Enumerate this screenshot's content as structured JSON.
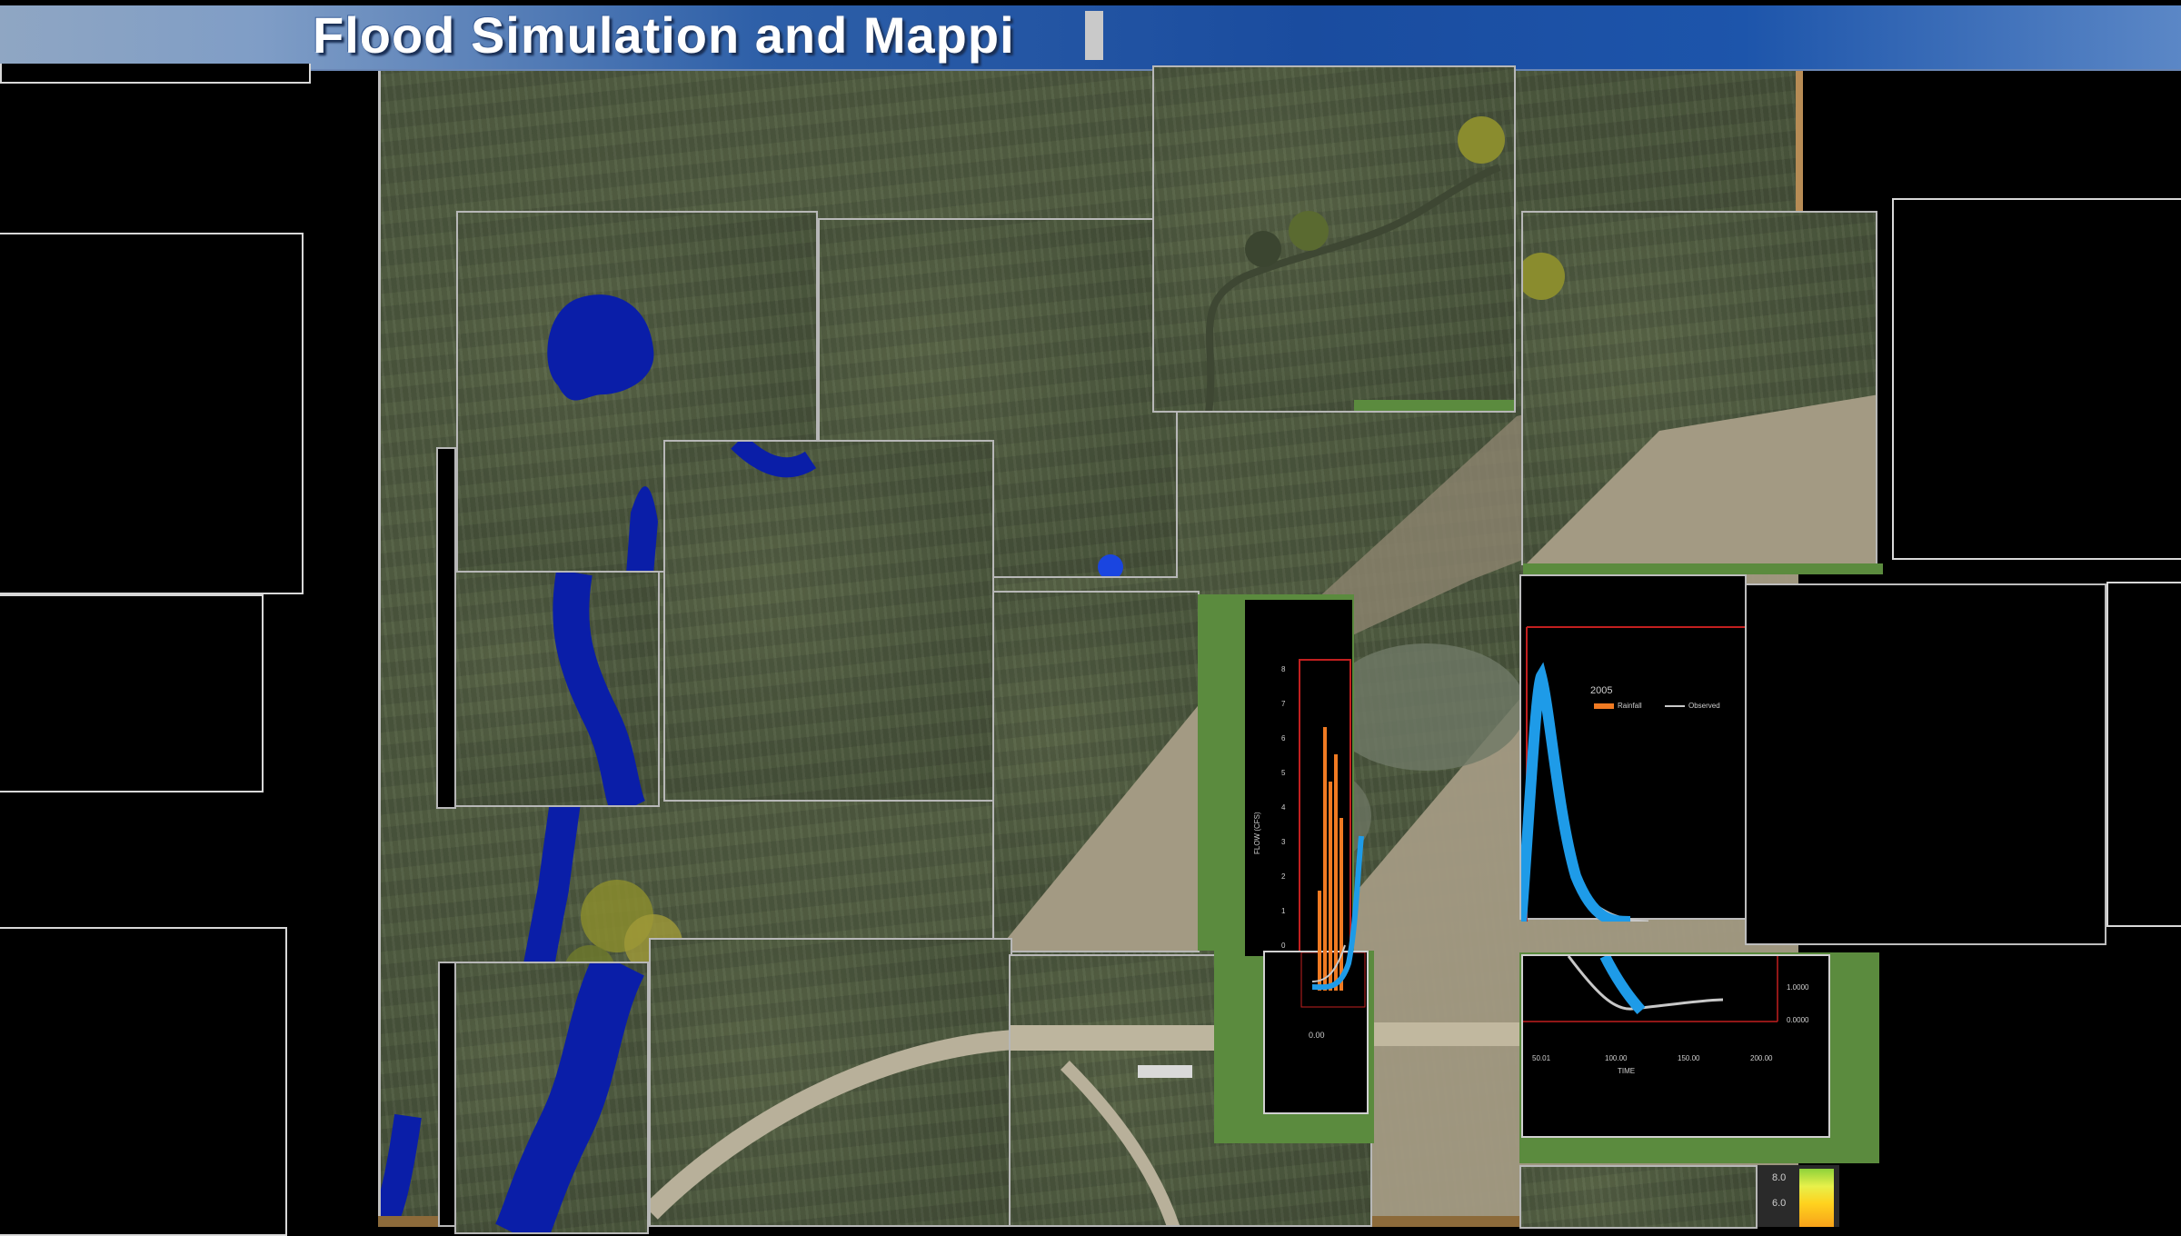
{
  "header": {
    "title": "Flood Simulation and Mappi"
  },
  "colors": {
    "title_bar": "#1a4c9f",
    "flood_water": "#0a1ea8",
    "field_green": "#4f5a41",
    "frame_green": "#5b8b3e",
    "chart_simulated": "#1e9be8",
    "chart_rainfall": "#f07a22",
    "chart_observed": "#c8c8c8"
  },
  "legend_chart": {
    "year_label": "2005",
    "legend_rainfall": "Rainfall",
    "legend_observed": "Observed",
    "x_axis_label": "TIME",
    "x_ticks": [
      "50.01",
      "100.00",
      "150.00",
      "200.00"
    ],
    "right_ticks": [
      "1.0000",
      "0.0000"
    ]
  },
  "left_chart": {
    "y_axis_label": "FLOW (CFS)",
    "y_ticks": [
      "8",
      "7",
      "6",
      "5",
      "4",
      "3",
      "2",
      "1",
      "0"
    ],
    "x_tick": "0.00"
  },
  "color_scale": {
    "ticks": [
      "8.0",
      "6.0"
    ]
  }
}
